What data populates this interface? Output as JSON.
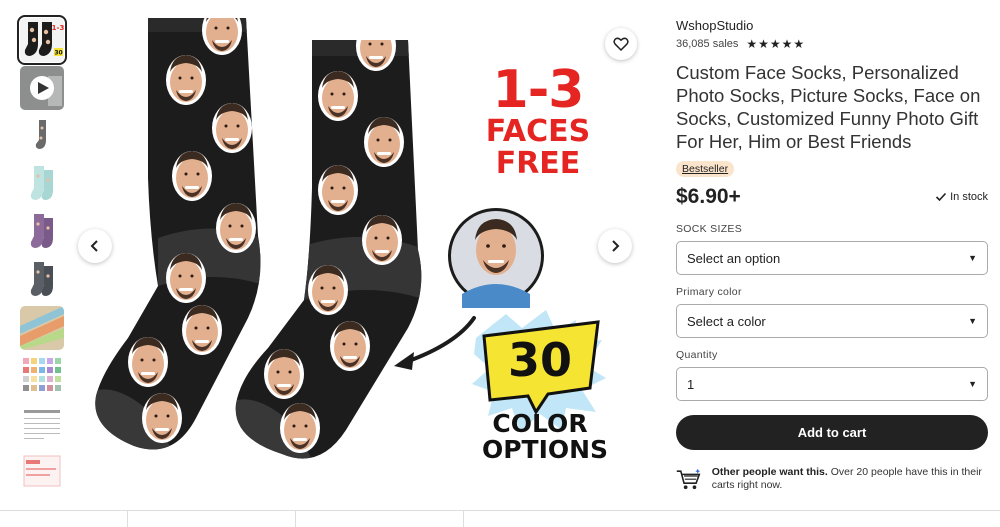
{
  "thumbnails": [
    {
      "kind": "sock-black",
      "active": true
    },
    {
      "kind": "video"
    },
    {
      "kind": "sock-grey"
    },
    {
      "kind": "sock-mint"
    },
    {
      "kind": "sock-purple"
    },
    {
      "kind": "sock-grey-2"
    },
    {
      "kind": "fabric-swatches"
    },
    {
      "kind": "color-chart"
    },
    {
      "kind": "size-chart"
    },
    {
      "kind": "info-card"
    }
  ],
  "gallery": {
    "promo_line1": "1-3",
    "promo_line2": "FACES",
    "promo_line3": "FREE",
    "burst_number": "30",
    "burst_line1": "COLOR",
    "burst_line2": "OPTIONS",
    "icons": {
      "prev": "chevron-left-icon",
      "next": "chevron-right-icon",
      "favorite": "heart-icon",
      "play": "play-icon"
    }
  },
  "product": {
    "shop_name": "WshopStudio",
    "sales": "36,085 sales",
    "rating_stars": "★★★★★",
    "title": "Custom Face Socks, Personalized Photo Socks, Picture Socks, Face on Socks, Customized Funny Photo Gift For Her, Him or Best Friends",
    "badge": "Bestseller",
    "price": "$6.90+",
    "stock": "In stock",
    "sock_sizes_label": "SOCK SIZES",
    "sock_sizes_value": "Select an option",
    "primary_color_label": "Primary color",
    "primary_color_value": "Select a color",
    "quantity_label": "Quantity",
    "quantity_value": "1",
    "add_to_cart": "Add to cart",
    "social_bold": "Other people want this.",
    "social_rest": " Over 20 people have this in their carts right now."
  },
  "colors": {
    "sock": "#1c1c1c",
    "sock_toe": "#3a3a3a",
    "promo_red": "#e52521",
    "burst_yellow": "#f6e432",
    "burst_blue": "#4ab8e8",
    "badge_bg": "#fbe4cc",
    "button_bg": "#222222"
  }
}
